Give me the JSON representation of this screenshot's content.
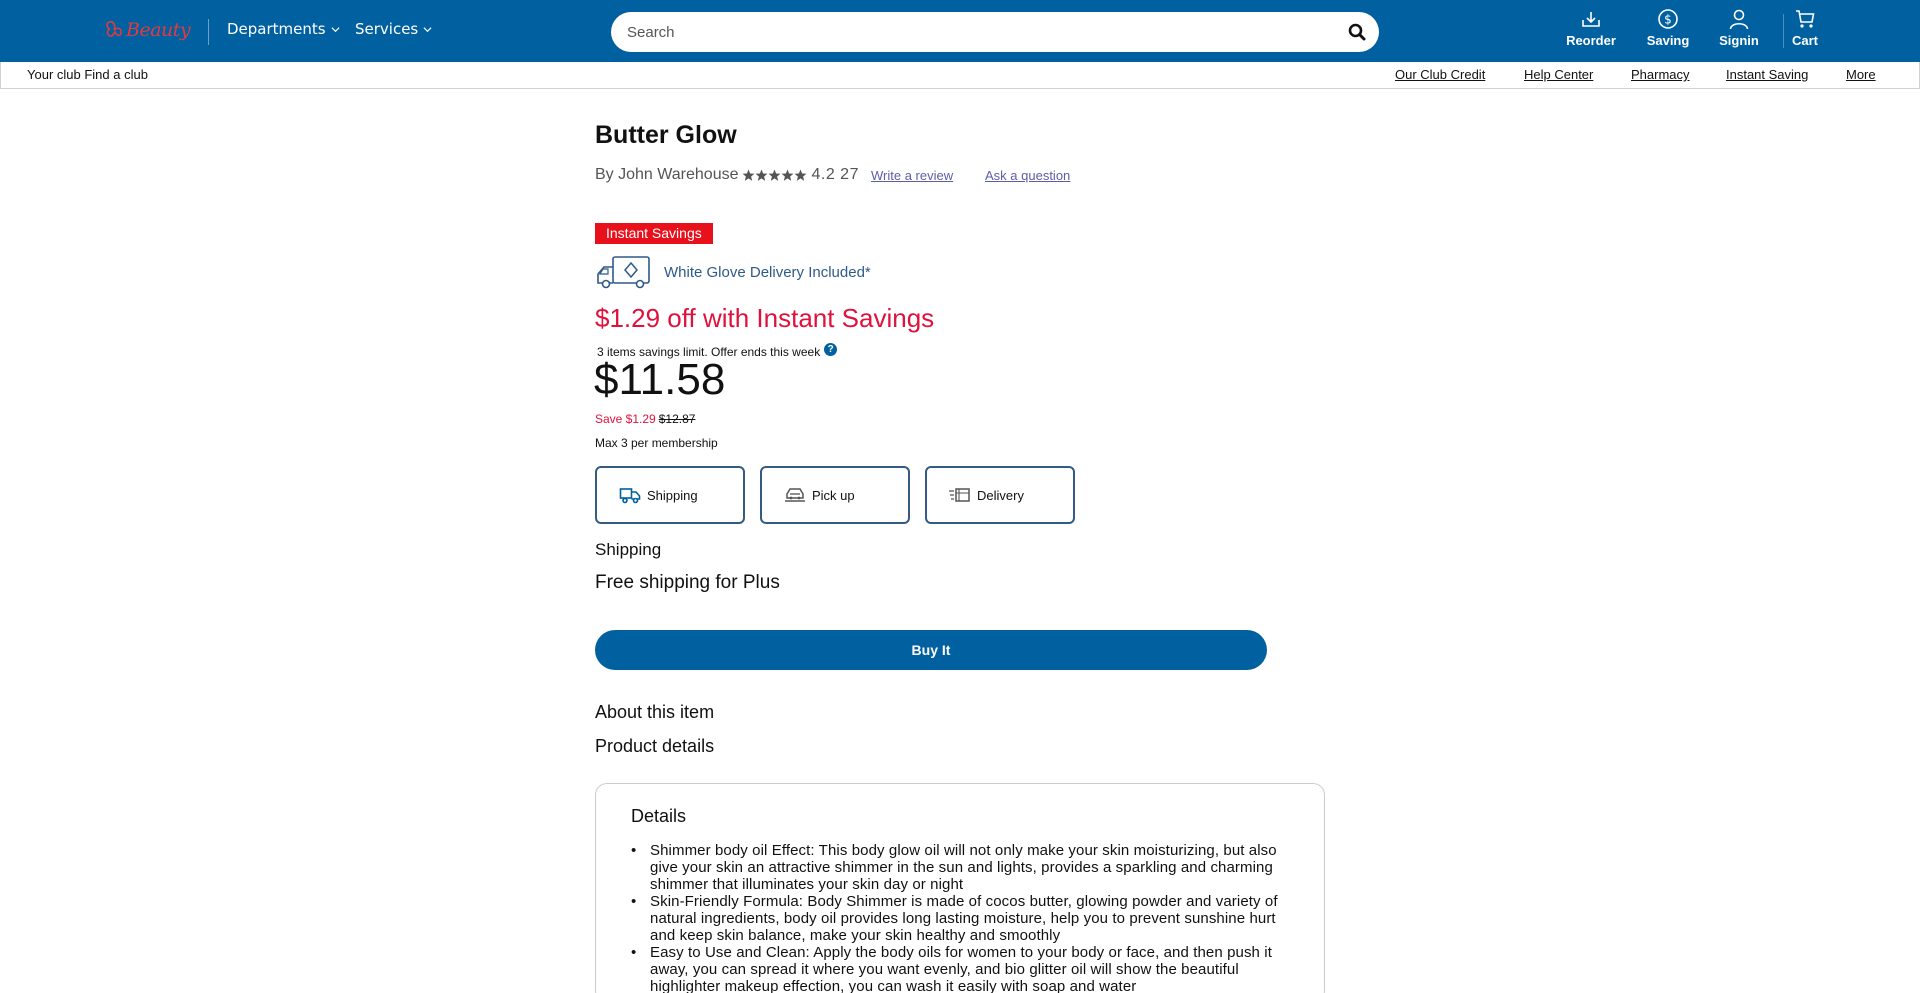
{
  "header": {
    "logo_text": "Beauty",
    "nav": [
      {
        "label": "Departments"
      },
      {
        "label": "Services"
      }
    ],
    "search": {
      "placeholder": "Search",
      "value": ""
    },
    "actions": [
      {
        "label": "Reorder",
        "icon": "reorder-icon"
      },
      {
        "label": "Saving",
        "icon": "dollar-circle-icon"
      },
      {
        "label": "Signin",
        "icon": "user-icon"
      },
      {
        "label": "Cart",
        "icon": "cart-icon"
      }
    ]
  },
  "subbar": {
    "club_text": "Your club Find a club",
    "links": [
      "Our Club Credit",
      "Help Center",
      "Pharmacy",
      "Instant Saving",
      "More"
    ]
  },
  "product": {
    "title": "Butter Glow",
    "brand": "By John Warehouse",
    "rating": 4.2,
    "rating_text": "4.2 27",
    "stars": 5,
    "write_review": "Write a review",
    "ask_question": "Ask a question",
    "badge": "Instant Savings",
    "delivery_included": "White Glove Delivery Included*",
    "savings_headline": "$1.29 off with Instant Savings",
    "limit_text": "3 items savings limit. Offer ends this week",
    "help_mark": "?",
    "price": "$11.58",
    "save_text": "Save $1.29",
    "was_price": "$12.87",
    "max_per": "Max 3 per membership",
    "fulfillment": [
      {
        "label": "Shipping",
        "icon": "truck-icon"
      },
      {
        "label": "Pick up",
        "icon": "pickup-car-icon"
      },
      {
        "label": "Delivery",
        "icon": "delivery-box-icon"
      }
    ],
    "shipping_heading": "Shipping",
    "shipping_note": "Free shipping for Plus",
    "buy_label": "Buy It",
    "about_heading": "About this item",
    "details_heading": "Product details",
    "details_card": {
      "title": "Details",
      "bullets": [
        "Shimmer body oil Effect: This body glow oil will not only make your skin moisturizing, but also give your skin an attractive shimmer in the sun and lights, provides a sparkling and charming shimmer that illuminates your skin day or night",
        "Skin-Friendly Formula: Body Shimmer is made of cocos butter, glowing powder and variety of natural ingredients, body oil provides long lasting moisture, help you to prevent sunshine hurt and keep skin balance, make your skin healthy and smoothly",
        "Easy to Use and Clean: Apply the body oils for women to your body or face, and then push it away, you can spread it where you want evenly, and bio glitter oil will show the beautiful highlighter makeup effection, you can wash it easily with soap and water"
      ]
    }
  },
  "colors": {
    "brand_blue": "#0060a0",
    "sale_red": "#e0123d",
    "badge_red": "#e8101b"
  }
}
